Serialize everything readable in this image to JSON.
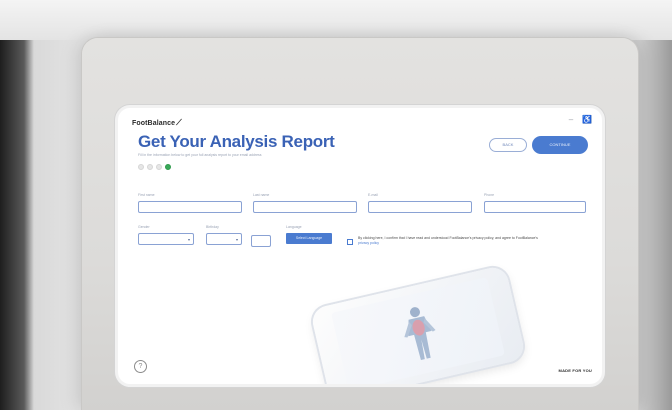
{
  "app": {
    "logo_text": "FootBalance",
    "brand_footer": "MADE FOR YOU"
  },
  "header": {
    "title": "Get Your Analysis Report",
    "subtitle": "Fill in the information below to get your full analysis report to your email address",
    "steps_total": 4,
    "active_step": 4
  },
  "buttons": {
    "back_label": "BACK",
    "continue_label": "CONTINUE",
    "select_language_label": "Select Language"
  },
  "form": {
    "first_name_label": "First name",
    "last_name_label": "Last name",
    "email_label": "E-mail",
    "phone_label": "Phone",
    "gender_label": "Gender",
    "birthday_label": "Birthday",
    "language_label": "Language"
  },
  "consent": {
    "text": "By clicking here, I confirm that I have read and understood FootBalance's privacy policy, and agree to FootBalance's ",
    "link": "privacy policy"
  },
  "icons": {
    "help": "help-circle-icon",
    "top": [
      "minus-icon",
      "accessibility-icon"
    ]
  },
  "colors": {
    "primary": "#4a7bd0",
    "title": "#3a62b5",
    "step_active": "#39a85a"
  }
}
